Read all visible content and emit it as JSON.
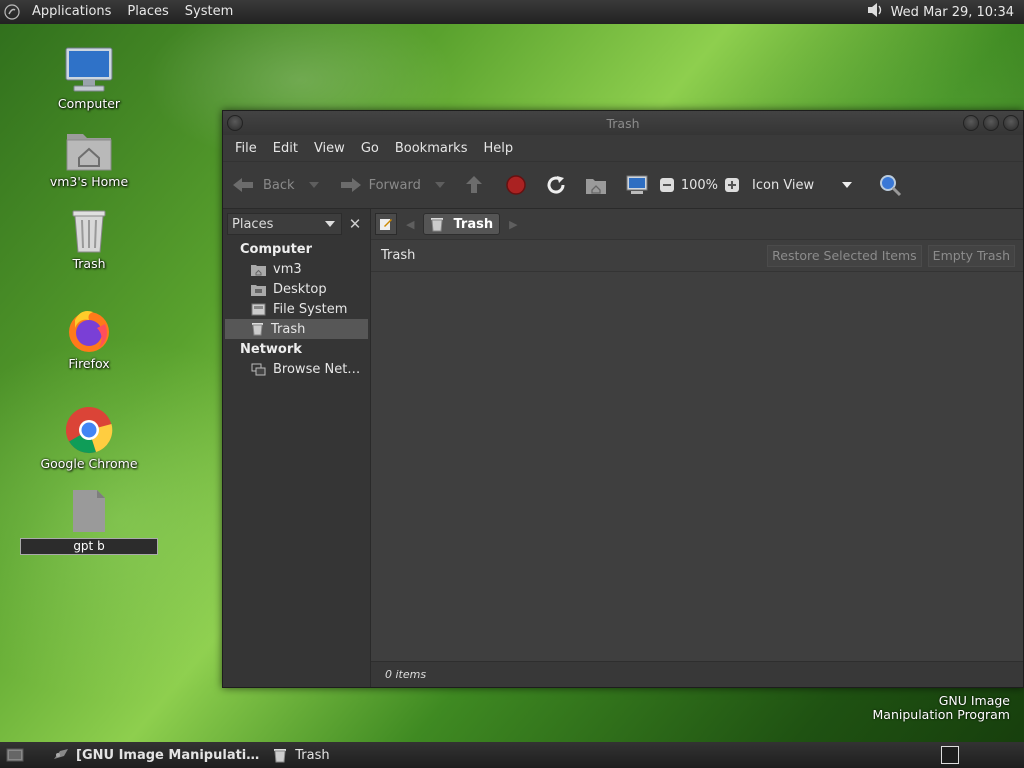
{
  "top_panel": {
    "menus": [
      "Applications",
      "Places",
      "System"
    ],
    "clock": "Wed Mar 29, 10:34",
    "icons": {
      "logo": "gnome-foot-icon",
      "volume": "speaker-icon"
    }
  },
  "desktop": {
    "icons": [
      {
        "label": "Computer",
        "icon": "monitor-icon"
      },
      {
        "label": "vm3's Home",
        "icon": "home-folder-icon"
      },
      {
        "label": "Trash",
        "icon": "trash-icon"
      },
      {
        "label": "Firefox",
        "icon": "firefox-icon"
      },
      {
        "label": "Google Chrome",
        "icon": "chrome-icon"
      },
      {
        "label": "",
        "icon": "document-icon",
        "rename_value": "gpt b"
      }
    ],
    "gimp_label_line1": "GNU Image",
    "gimp_label_line2": "Manipulation Program"
  },
  "window": {
    "title": "Trash",
    "menu": [
      "File",
      "Edit",
      "View",
      "Go",
      "Bookmarks",
      "Help"
    ],
    "toolbar": {
      "back": "Back",
      "forward": "Forward",
      "zoom": "100%",
      "view_mode": "Icon View"
    },
    "sidebar": {
      "selector": "Places",
      "sections": [
        {
          "title": "Computer",
          "items": [
            "vm3",
            "Desktop",
            "File System",
            "Trash"
          ]
        },
        {
          "title": "Network",
          "items": [
            "Browse Net…"
          ]
        }
      ],
      "selected": "Trash"
    },
    "pathbar": {
      "current": "Trash"
    },
    "infobar": {
      "label": "Trash",
      "restore_button": "Restore Selected Items",
      "empty_button": "Empty Trash"
    },
    "status": "0 items"
  },
  "bottom_panel": {
    "tasks": [
      "[GNU Image Manipulati…",
      "Trash"
    ]
  }
}
